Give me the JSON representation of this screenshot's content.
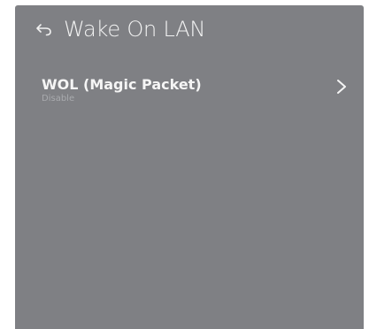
{
  "header": {
    "title": "Wake On LAN",
    "back_icon": "back-arrow-icon"
  },
  "menu": {
    "items": [
      {
        "label": "WOL (Magic Packet)",
        "value": "Disable",
        "icon": "chevron-right-icon"
      }
    ]
  },
  "colors": {
    "panel_background": "#7f8084",
    "text_primary": "#f5f5f5",
    "text_secondary": "#a9aaae"
  }
}
